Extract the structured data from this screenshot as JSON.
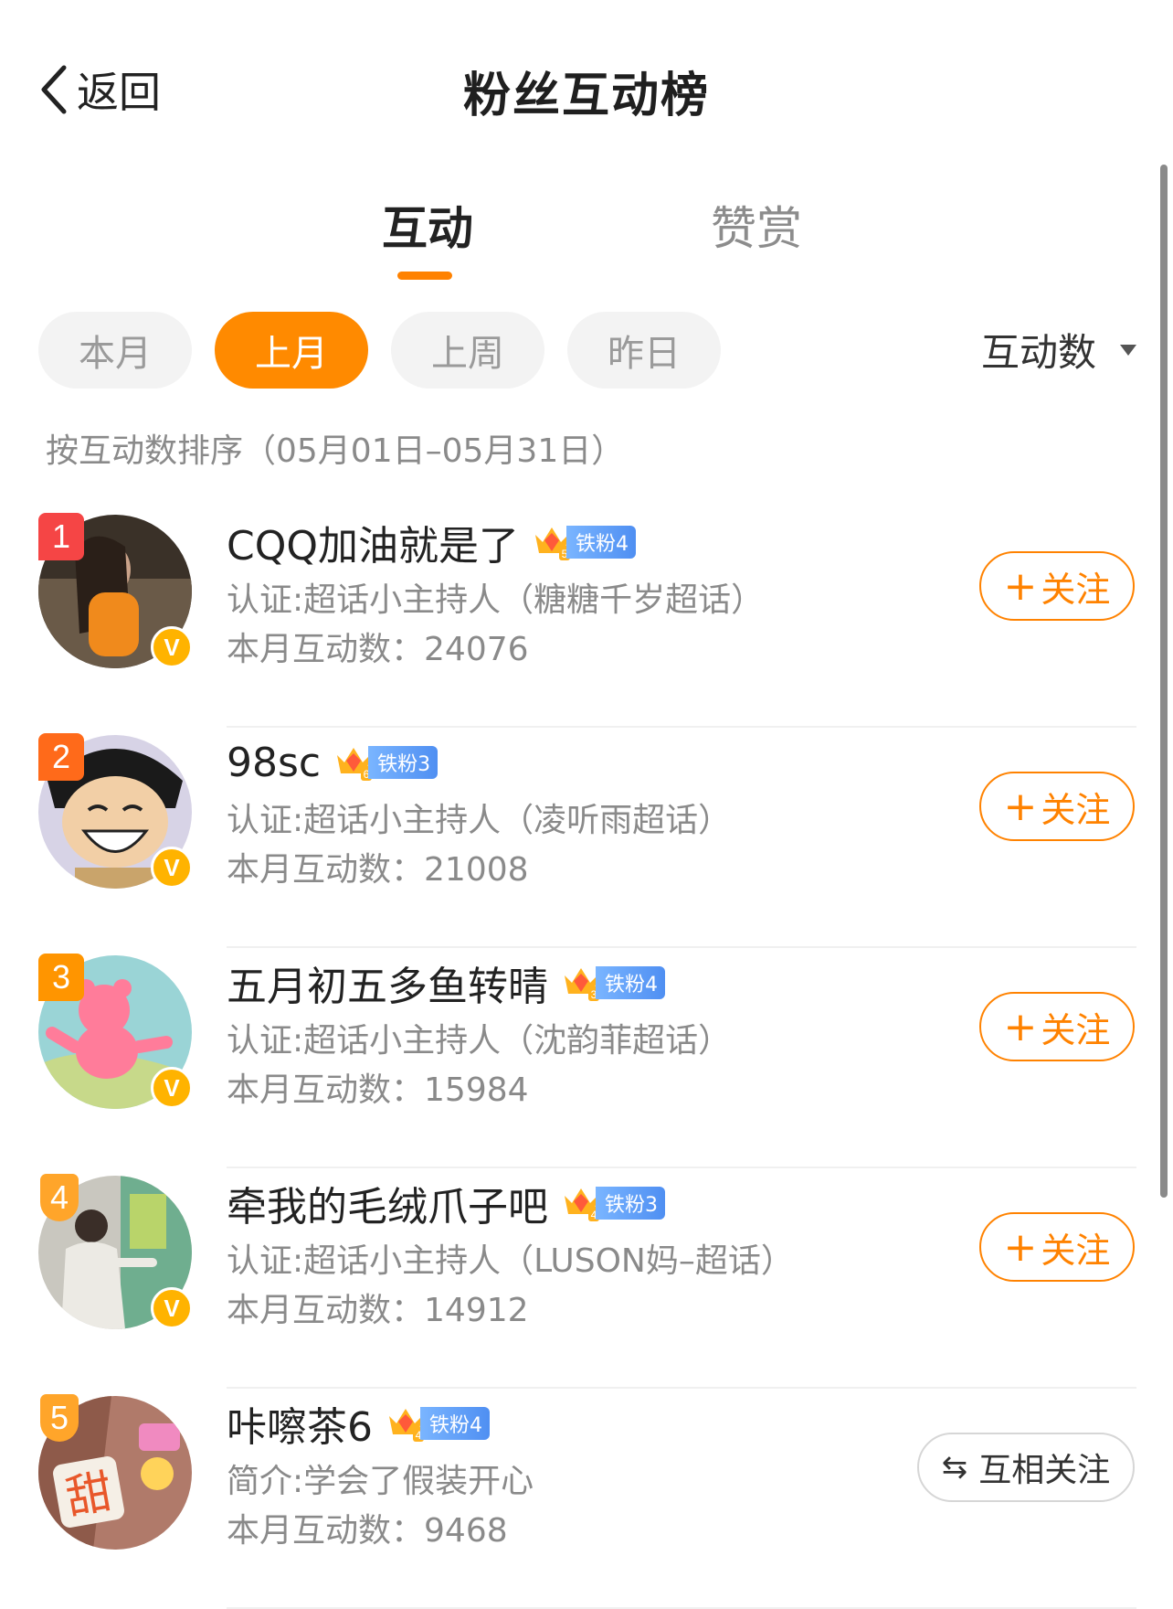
{
  "header": {
    "back_label": "返回",
    "title": "粉丝互动榜"
  },
  "tabs": [
    {
      "label": "互动",
      "active": true
    },
    {
      "label": "赞赏",
      "active": false
    }
  ],
  "filters": [
    {
      "label": "本月",
      "active": false
    },
    {
      "label": "上月",
      "active": true
    },
    {
      "label": "上周",
      "active": false
    },
    {
      "label": "昨日",
      "active": false
    }
  ],
  "sort": {
    "label": "互动数"
  },
  "range_text": "按互动数排序（05月01日–05月31日）",
  "colors": {
    "accent": "#ff8200",
    "rank1": "#f54545",
    "rank2": "#ff6a1a",
    "rank3": "#ff9500",
    "fan_tag": "#4f8ff2"
  },
  "fans": [
    {
      "rank": "1",
      "name": "CQQ加油就是了",
      "crown_level": "5",
      "fan_level": "铁粉4",
      "desc": "认证:超话小主持人（糖糖千岁超话）",
      "count_label": "本月互动数：",
      "count": "24076",
      "action": "关注",
      "action_icon": "plus-icon",
      "verified": true
    },
    {
      "rank": "2",
      "name": "98sc",
      "crown_level": "6",
      "fan_level": "铁粉3",
      "desc": "认证:超话小主持人（凌听雨超话）",
      "count_label": "本月互动数：",
      "count": "21008",
      "action": "关注",
      "action_icon": "plus-icon",
      "verified": true
    },
    {
      "rank": "3",
      "name": "五月初五多鱼转晴",
      "crown_level": "3",
      "fan_level": "铁粉4",
      "desc": "认证:超话小主持人（沈韵菲超话）",
      "count_label": "本月互动数：",
      "count": "15984",
      "action": "关注",
      "action_icon": "plus-icon",
      "verified": true
    },
    {
      "rank": "4",
      "name": "牵我的毛绒爪子吧",
      "crown_level": "4",
      "fan_level": "铁粉3",
      "desc": "认证:超话小主持人（LUSON妈–超话）",
      "count_label": "本月互动数：",
      "count": "14912",
      "action": "关注",
      "action_icon": "plus-icon",
      "verified": true
    },
    {
      "rank": "5",
      "name": "咔嚓茶6",
      "crown_level": "4",
      "fan_level": "铁粉4",
      "desc": "简介:学会了假装开心",
      "count_label": "本月互动数：",
      "count": "9468",
      "action": "互相关注",
      "action_icon": "swap-icon",
      "verified": false
    }
  ]
}
